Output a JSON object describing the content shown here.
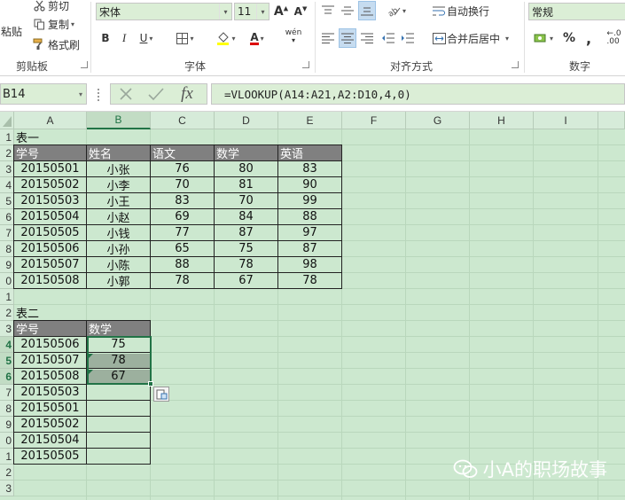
{
  "ribbon": {
    "clipboard": {
      "cut": "剪切",
      "copy": "复制",
      "format_painter": "格式刷",
      "paste": "粘贴",
      "label": "剪贴板"
    },
    "font": {
      "name": "宋体",
      "size": "11",
      "bold": "B",
      "italic": "I",
      "underline": "U",
      "label": "字体",
      "wen": "wén"
    },
    "alignment": {
      "wrap": "自动换行",
      "merge": "合并后居中",
      "label": "对齐方式"
    },
    "number": {
      "format": "常规",
      "percent": "%",
      "comma": ",",
      "label": "数字"
    }
  },
  "formula_bar": {
    "cell_ref": "B14",
    "fx": "fx",
    "formula": "=VLOOKUP(A14:A21,A2:D10,4,0)"
  },
  "columns": [
    "A",
    "B",
    "C",
    "D",
    "E",
    "F",
    "G",
    "H",
    "I"
  ],
  "rows": [
    "1",
    "2",
    "3",
    "4",
    "5",
    "6",
    "7",
    "8",
    "9",
    "0",
    "1",
    "2",
    "3",
    "4",
    "5",
    "6",
    "7",
    "8",
    "9",
    "0",
    "1",
    "2",
    "3"
  ],
  "table1": {
    "title": "表一",
    "headers": [
      "学号",
      "姓名",
      "语文",
      "数学",
      "英语"
    ],
    "rows": [
      [
        "20150501",
        "小张",
        "76",
        "80",
        "83"
      ],
      [
        "20150502",
        "小李",
        "70",
        "81",
        "90"
      ],
      [
        "20150503",
        "小王",
        "83",
        "70",
        "99"
      ],
      [
        "20150504",
        "小赵",
        "69",
        "84",
        "88"
      ],
      [
        "20150505",
        "小钱",
        "77",
        "87",
        "97"
      ],
      [
        "20150506",
        "小孙",
        "65",
        "75",
        "87"
      ],
      [
        "20150507",
        "小陈",
        "88",
        "78",
        "98"
      ],
      [
        "20150508",
        "小郭",
        "78",
        "67",
        "78"
      ]
    ]
  },
  "table2": {
    "title": "表二",
    "headers": [
      "学号",
      "数学"
    ],
    "rows": [
      [
        "20150506",
        "75"
      ],
      [
        "20150507",
        "78"
      ],
      [
        "20150508",
        "67"
      ],
      [
        "20150503",
        ""
      ],
      [
        "20150501",
        ""
      ],
      [
        "20150502",
        ""
      ],
      [
        "20150504",
        ""
      ],
      [
        "20150505",
        ""
      ]
    ]
  },
  "watermark": "小A的职场故事",
  "colors": {
    "sheet_bg": "#cce8cf",
    "header_fill": "#808080",
    "accent": "#217346"
  }
}
